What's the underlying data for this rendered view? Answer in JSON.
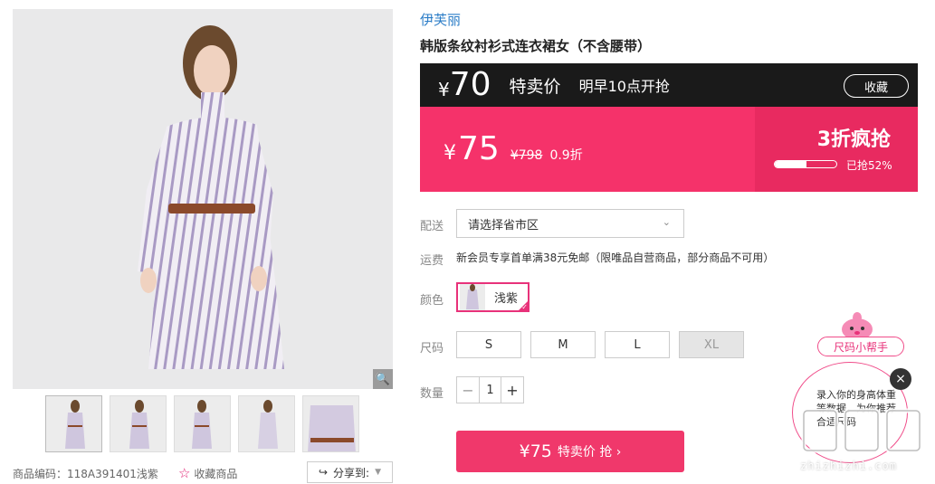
{
  "brand": "伊芙丽",
  "product_title": "韩版条纹衬衫式连衣裙女（不含腰带）",
  "flash": {
    "currency": "¥",
    "price": "70",
    "label": "特卖价",
    "start_time": "明早10点开抢",
    "collect_label": "收藏"
  },
  "sale": {
    "currency": "¥",
    "price": "75",
    "original_price": "¥798",
    "discount": "0.9折",
    "slogan": "3折疯抢",
    "sold_text": "已抢52%",
    "sold_percent": 52,
    "colors": {
      "dark": "#1a1a1a",
      "pink": "#f5326a",
      "pink_dark": "#e82a60"
    }
  },
  "delivery": {
    "label": "配送",
    "placeholder": "请选择省市区"
  },
  "shipping": {
    "label": "运费",
    "text": "新会员专享首单满38元免邮（限唯品自营商品，部分商品不可用）"
  },
  "color": {
    "label": "颜色",
    "selected": "浅紫"
  },
  "size": {
    "label": "尺码",
    "options": [
      "S",
      "M",
      "L",
      "XL"
    ]
  },
  "quantity": {
    "label": "数量",
    "value": "1",
    "minus": "−",
    "plus": "+"
  },
  "buy_button": {
    "price": "¥75",
    "label": "特卖价 抢 ›"
  },
  "gallery": {
    "product_code": "商品编码：118A391401浅紫",
    "favorite_label": "收藏商品",
    "share_label": "分享到:"
  },
  "size_helper": {
    "title": "尺码小帮手",
    "bubble_text": "录入你的身高体重等数据，为你推荐合适尺码",
    "watermark": "zhizhizhi.com"
  }
}
